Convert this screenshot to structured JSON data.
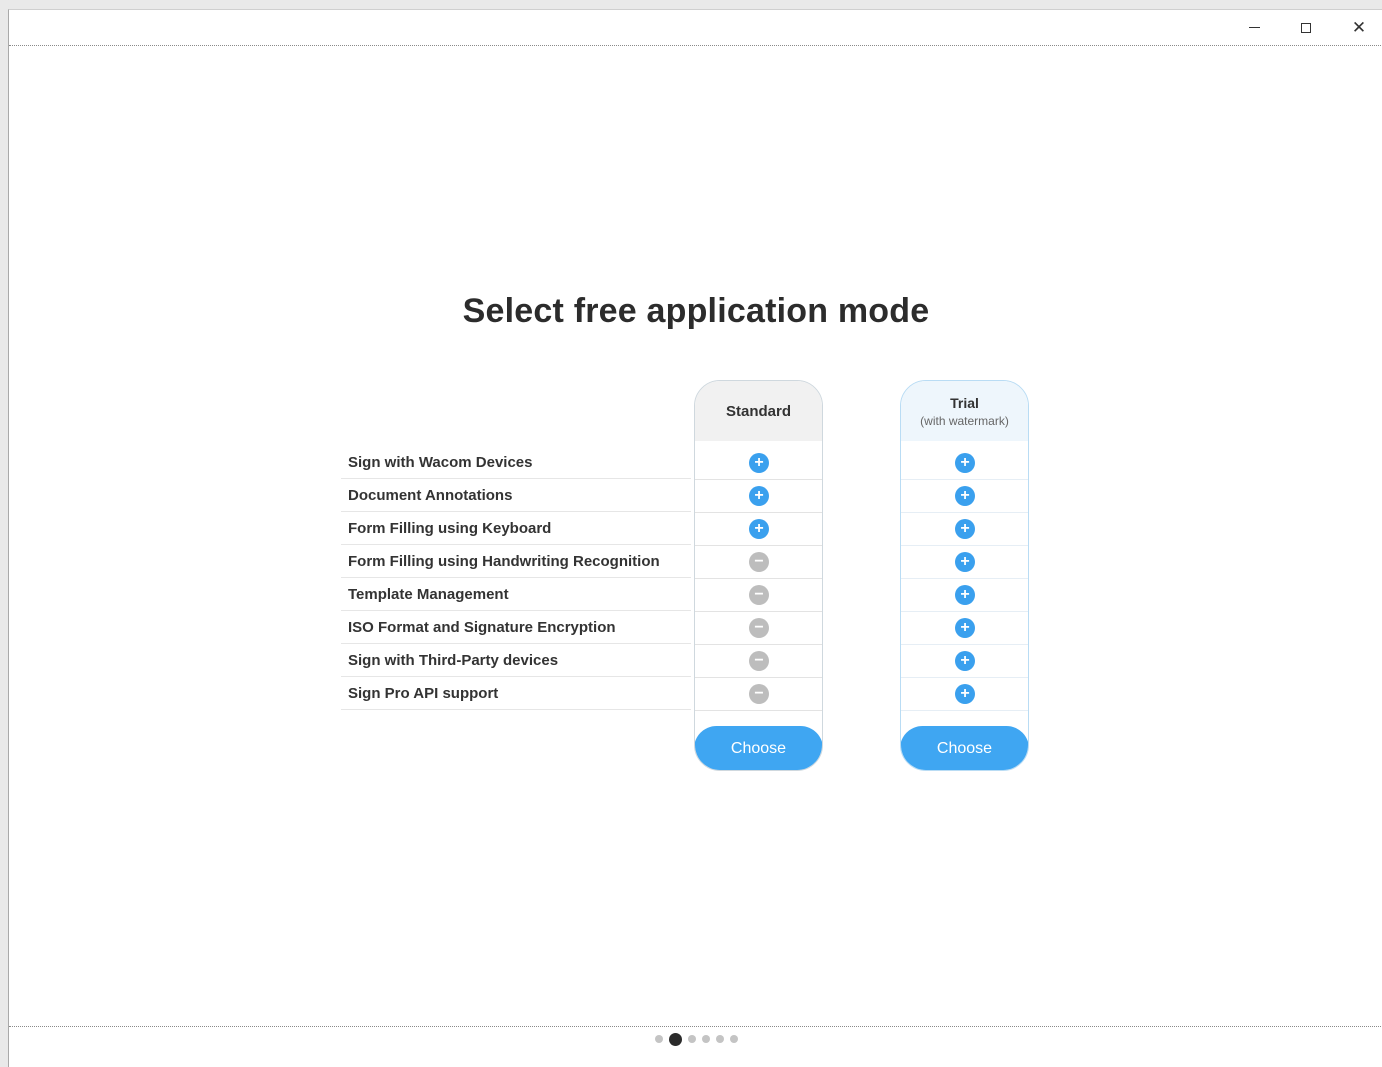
{
  "window": {
    "minimize_icon": "minimize-icon",
    "maximize_icon": "maximize-icon",
    "close_icon": "close-icon",
    "close_glyph": "✕"
  },
  "title": "Select free application mode",
  "features": [
    "Sign with Wacom Devices",
    "Document Annotations",
    "Form Filling using Keyboard",
    "Form Filling using Handwriting Recognition",
    "Template Management",
    "ISO Format and Signature Encryption",
    "Sign with Third-Party devices",
    "Sign Pro API support"
  ],
  "columns": {
    "standard": {
      "name": "Standard",
      "included": [
        true,
        true,
        true,
        false,
        false,
        false,
        false,
        false
      ],
      "button": "Choose"
    },
    "trial": {
      "name": "Trial",
      "note": "(with watermark)",
      "included": [
        true,
        true,
        true,
        true,
        true,
        true,
        true,
        true
      ],
      "button": "Choose"
    }
  },
  "icons": {
    "included": "plus-circle-icon",
    "excluded": "minus-circle-icon",
    "plus_glyph": "+",
    "minus_glyph": "−"
  },
  "colors": {
    "accent": "#3fa6f2",
    "included_icon": "#3aa0ee",
    "excluded_icon": "#bdbdbd"
  },
  "pager": {
    "count": 6,
    "active_index": 1
  }
}
